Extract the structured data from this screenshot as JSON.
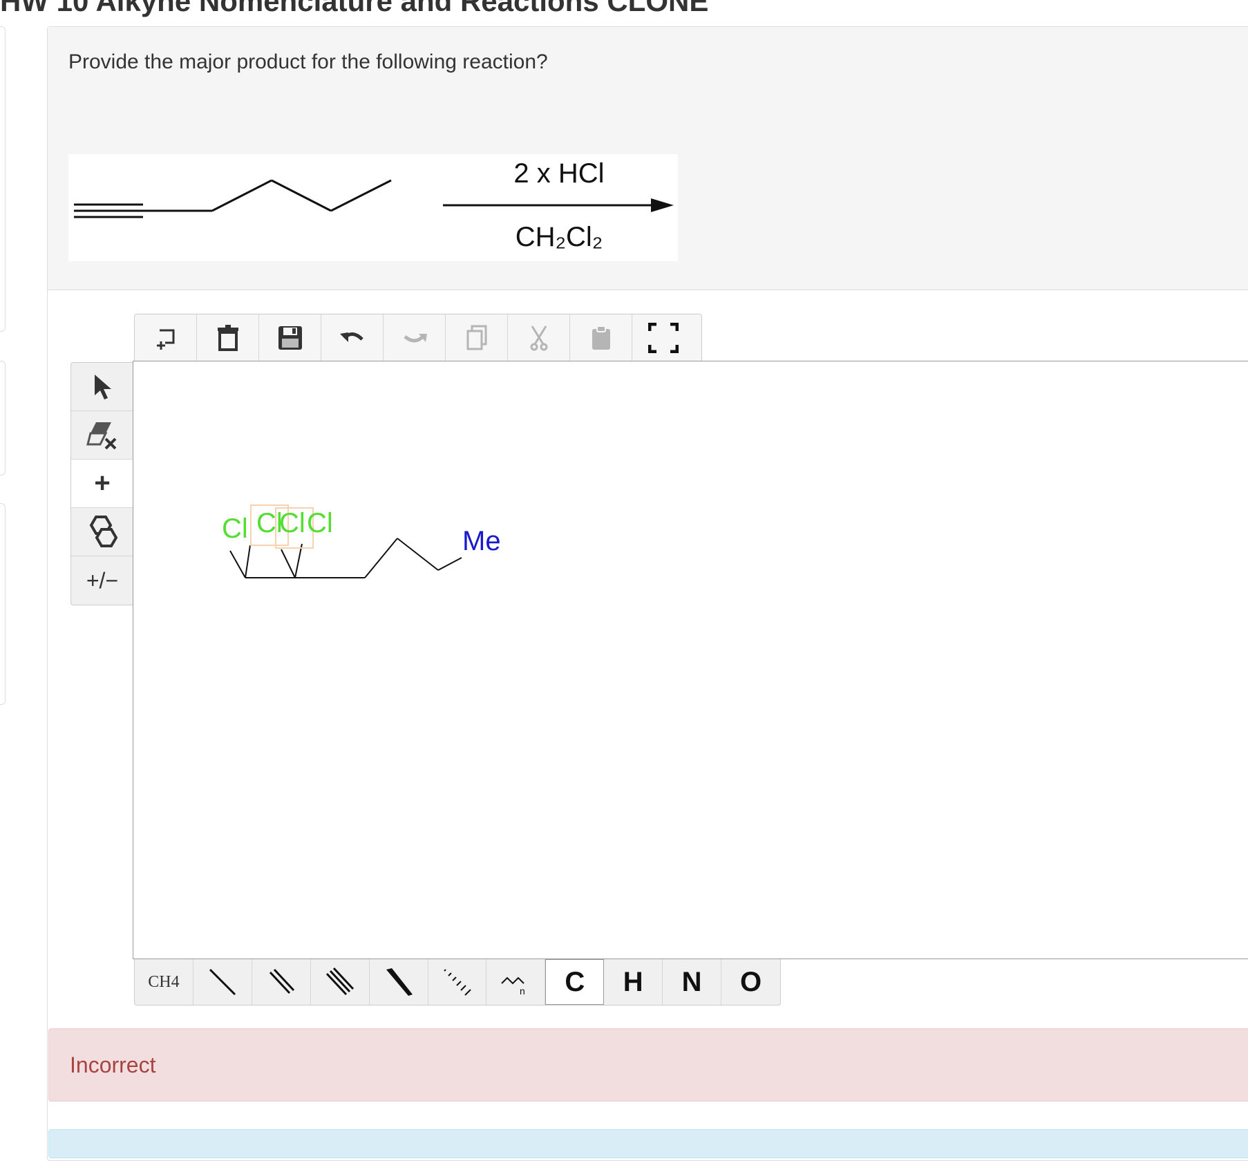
{
  "page": {
    "heading": "HW 10 Alkyne Nomenclature and Reactions CLONE"
  },
  "question": {
    "prompt": "Provide the major product for the following reaction?"
  },
  "reaction": {
    "reagent_top": "2 x HCl",
    "reagent_bottom": "CH₂Cl₂"
  },
  "editor": {
    "top_toolbar": [
      {
        "icon": "new-document-icon",
        "enabled": true
      },
      {
        "icon": "trash-icon",
        "enabled": true
      },
      {
        "icon": "save-icon",
        "enabled": true
      },
      {
        "icon": "undo-icon",
        "enabled": true
      },
      {
        "icon": "redo-icon",
        "enabled": false
      },
      {
        "icon": "copy-icon",
        "enabled": false
      },
      {
        "icon": "cut-icon",
        "enabled": false
      },
      {
        "icon": "paste-icon",
        "enabled": false
      },
      {
        "icon": "fullscreen-icon",
        "enabled": true
      }
    ],
    "left_toolbar": [
      {
        "icon": "select-arrow-icon",
        "label": ""
      },
      {
        "icon": "eraser-icon",
        "label": ""
      },
      {
        "icon": "plus-icon",
        "label": "+"
      },
      {
        "icon": "ring-template-icon",
        "label": ""
      },
      {
        "icon": "charge-icon",
        "label": "+/−"
      }
    ],
    "canvas_labels": {
      "cl_1": "Cl",
      "cl_2": "Cl",
      "cl_3": "Cl",
      "cl_4": "Cl",
      "me": "Me"
    },
    "bottom_toolbar": {
      "ch4_label": "CH4",
      "atoms": [
        "C",
        "H",
        "N",
        "O"
      ],
      "selected_atom": "C"
    }
  },
  "colors": {
    "chlorine": "#55dd33",
    "methyl": "#1a1acc",
    "highlight": "#f5d2b0"
  },
  "feedback": {
    "status": "Incorrect"
  }
}
